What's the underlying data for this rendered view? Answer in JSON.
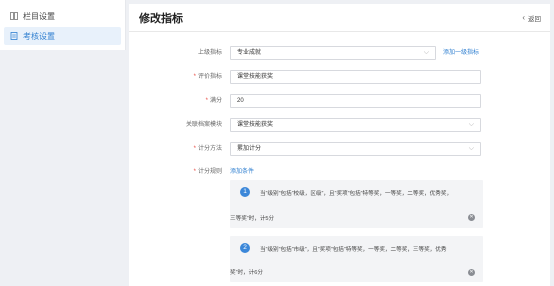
{
  "sidebar": {
    "items": [
      {
        "label": "栏目设置",
        "icon": "column-icon"
      },
      {
        "label": "考核设置",
        "icon": "document-icon"
      }
    ]
  },
  "header": {
    "title": "修改指标",
    "back_label": "返回"
  },
  "form": {
    "parent": {
      "label": "上级指标",
      "value": "专业成就",
      "add_link": "添加一级指标"
    },
    "name": {
      "label": "评价指标",
      "value": "课堂技能获奖"
    },
    "score": {
      "label": "满分",
      "value": "20"
    },
    "module": {
      "label": "关联档案模块",
      "value": "课堂技能获奖"
    },
    "method": {
      "label": "计分方法",
      "value": "累加计分"
    },
    "rules": {
      "label": "计分规则",
      "add_link": "添加条件",
      "items": [
        {
          "num": "1",
          "line1": "当“级别”包括“校级，区级”，且“奖项”包括“特等奖，一等奖，二等奖，优秀奖，",
          "line2": "三等奖”时，计5分"
        },
        {
          "num": "2",
          "line1": "当“级别”包括“市级”，且“奖项”包括“特等奖，一等奖，二等奖，三等奖，优秀",
          "line2": "奖”时，计6分"
        }
      ]
    }
  },
  "colors": {
    "accent": "#2f7fd0",
    "required": "#e8453c",
    "badge": "#3b87d9"
  }
}
